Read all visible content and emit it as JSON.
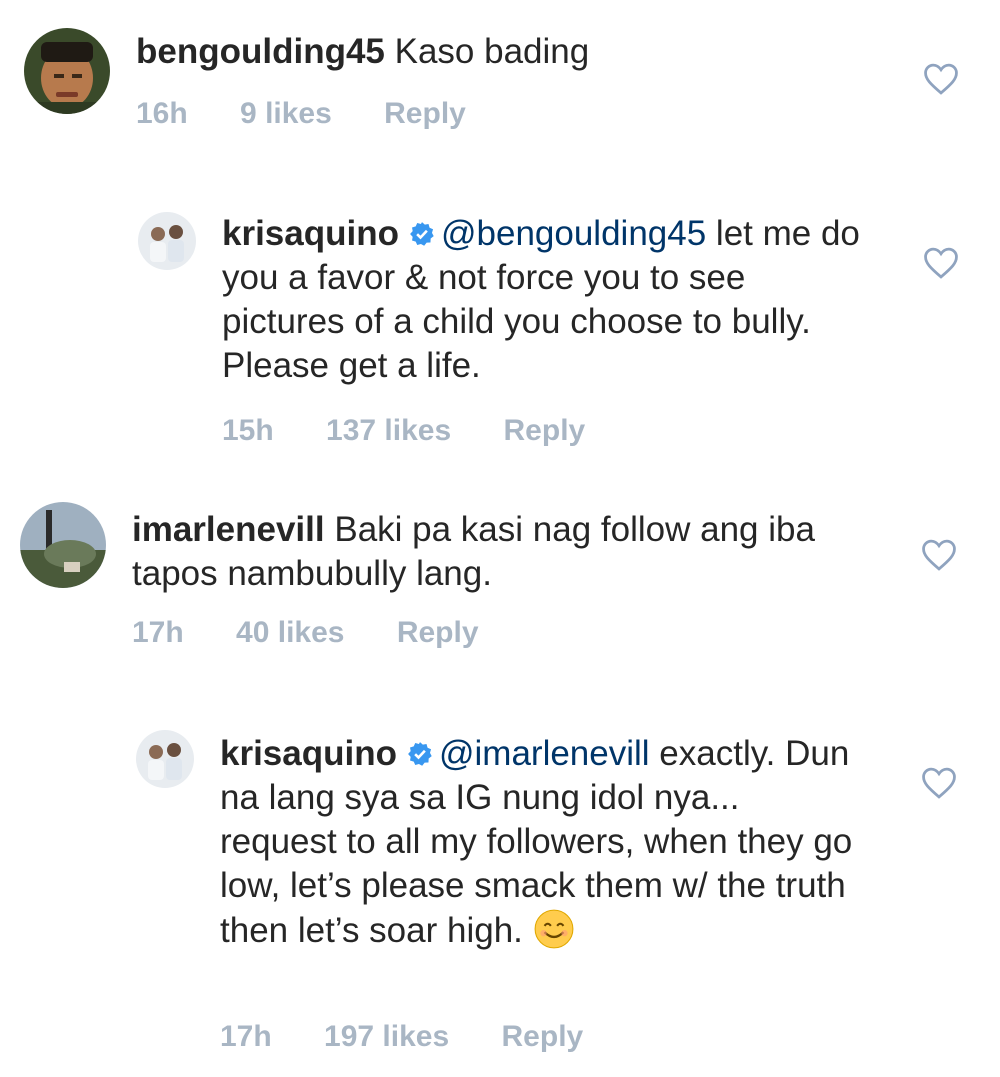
{
  "comments": [
    {
      "username": "bengoulding45",
      "text": "Kaso bading",
      "time": "16h",
      "likes": "9 likes",
      "reply": "Reply",
      "avatar_icon": "avatar-man-photo"
    },
    {
      "username": "krisaquino",
      "mention": "@bengoulding45",
      "text": " let me do you a favor & not force you to see pictures of a child you choose to bully. Please get a life.",
      "time": "15h",
      "likes": "137 likes",
      "reply": "Reply",
      "avatar_icon": "avatar-family-photo",
      "verified_icon": "verified-badge-icon"
    },
    {
      "username": "imarlenevill",
      "text": "Baki pa kasi nag follow ang iba tapos nambubully lang.",
      "time": "17h",
      "likes": "40 likes",
      "reply": "Reply",
      "avatar_icon": "avatar-landscape-photo"
    },
    {
      "username": "krisaquino",
      "mention": "@imarlenevill",
      "text": " exactly. Dun na lang sya sa IG nung idol nya... request to all my followers, when they go low, let’s please smack them w/ the truth then let’s soar high.",
      "emoji": "smiling-face-emoji",
      "time": "17h",
      "likes": "197 likes",
      "reply": "Reply",
      "avatar_icon": "avatar-family-photo",
      "verified_icon": "verified-badge-icon"
    }
  ],
  "colors": {
    "text": "#262626",
    "mention": "#003569",
    "meta": "#a9b6c4",
    "verified": "#3897f0",
    "heart_outline": "#8fa3bf"
  }
}
